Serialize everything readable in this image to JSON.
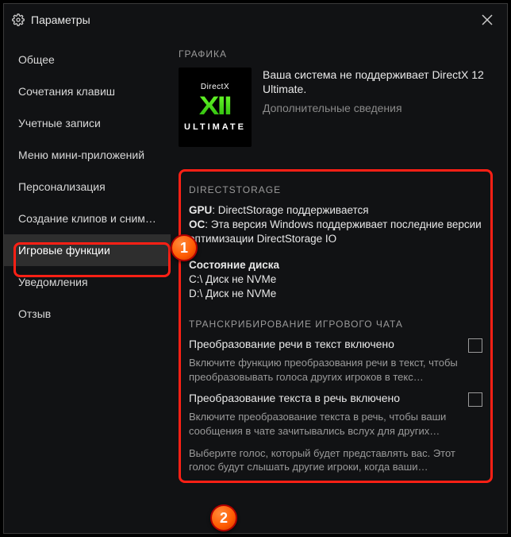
{
  "window": {
    "title": "Параметры"
  },
  "sidebar": {
    "items": [
      {
        "label": "Общее"
      },
      {
        "label": "Сочетания клавиш"
      },
      {
        "label": "Учетные записи"
      },
      {
        "label": "Меню мини-приложений"
      },
      {
        "label": "Персонализация"
      },
      {
        "label": "Создание клипов и сним…"
      },
      {
        "label": "Игровые функции"
      },
      {
        "label": "Уведомления"
      },
      {
        "label": "Отзыв"
      }
    ],
    "active_index": 6
  },
  "graphics": {
    "title": "ГРАФИКА",
    "badge_top": "DirectX",
    "badge_mid": "XII",
    "badge_bottom": "ULTIMATE",
    "message": "Ваша система не поддерживает DirectX 12 Ultimate.",
    "link": "Дополнительные сведения"
  },
  "directstorage": {
    "title": "DIRECTSTORAGE",
    "gpu_label": "GPU",
    "gpu_text": ": DirectStorage поддерживается",
    "os_label": "ОС",
    "os_text": ": Эта версия Windows поддерживает последние версии оптимизации DirectStorage IO",
    "disk_title": "Состояние диска",
    "disk_c": "C:\\ Диск не NVMe",
    "disk_d": "D:\\ Диск не NVMe"
  },
  "transcribe": {
    "title": "ТРАНСКРИБИРОВАНИЕ ИГРОВОГО ЧАТА",
    "opt1_label": "Преобразование речи в текст включено",
    "opt1_desc": "Включите функцию преобразования речи в текст, чтобы преобразовывать голоса других игроков в текс…",
    "opt2_label": "Преобразование текста в речь включено",
    "opt2_desc": "Включите преобразование текста в речь, чтобы ваши сообщения в чате зачитывались вслух для других…",
    "voice_desc": "Выберите голос, который будет представлять вас. Этот голос будут слышать другие игроки, когда ваши…"
  },
  "callouts": {
    "c1": "1",
    "c2": "2"
  }
}
